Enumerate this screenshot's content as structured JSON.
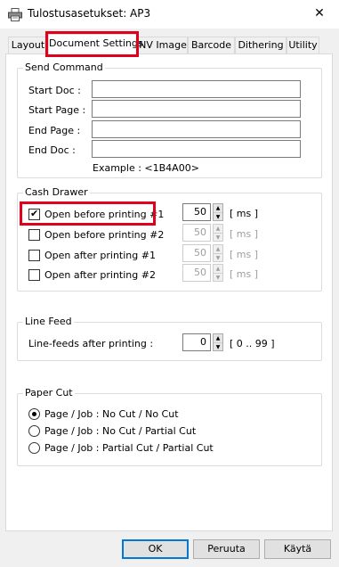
{
  "window": {
    "title": "Tulostusasetukset: AP3",
    "close_glyph": "✕",
    "icon": "printer-icon"
  },
  "tabs": [
    {
      "label": "Layout"
    },
    {
      "label": "Document Settings"
    },
    {
      "label": "NV Image"
    },
    {
      "label": "Barcode"
    },
    {
      "label": "Dithering"
    },
    {
      "label": "Utility"
    }
  ],
  "send_command": {
    "legend": "Send Command",
    "fields": [
      {
        "label": "Start Doc :",
        "value": ""
      },
      {
        "label": "Start Page :",
        "value": ""
      },
      {
        "label": "End Page :",
        "value": ""
      },
      {
        "label": "End Doc :",
        "value": ""
      }
    ],
    "example": "Example : <1B4A00>"
  },
  "cash_drawer": {
    "legend": "Cash Drawer",
    "options": [
      {
        "label": "Open before printing #1",
        "checked": true,
        "value": "50",
        "unit": "[ ms ]",
        "enabled": true
      },
      {
        "label": "Open before printing #2",
        "checked": false,
        "value": "50",
        "unit": "[ ms ]",
        "enabled": false
      },
      {
        "label": "Open after printing #1",
        "checked": false,
        "value": "50",
        "unit": "[ ms ]",
        "enabled": false
      },
      {
        "label": "Open after printing #2",
        "checked": false,
        "value": "50",
        "unit": "[ ms ]",
        "enabled": false
      }
    ]
  },
  "line_feed": {
    "legend": "Line Feed",
    "label": "Line-feeds after printing :",
    "value": "0",
    "range": "[ 0 .. 99 ]"
  },
  "paper_cut": {
    "legend": "Paper Cut",
    "options": [
      {
        "label": "Page / Job : No Cut / No Cut",
        "selected": true
      },
      {
        "label": "Page / Job : No Cut / Partial Cut",
        "selected": false
      },
      {
        "label": "Page / Job : Partial Cut / Partial Cut",
        "selected": false
      }
    ]
  },
  "buttons": {
    "ok": "OK",
    "cancel": "Peruuta",
    "apply": "Käytä"
  },
  "colors": {
    "highlight": "#e0001b",
    "default_button_border": "#0078d7"
  }
}
